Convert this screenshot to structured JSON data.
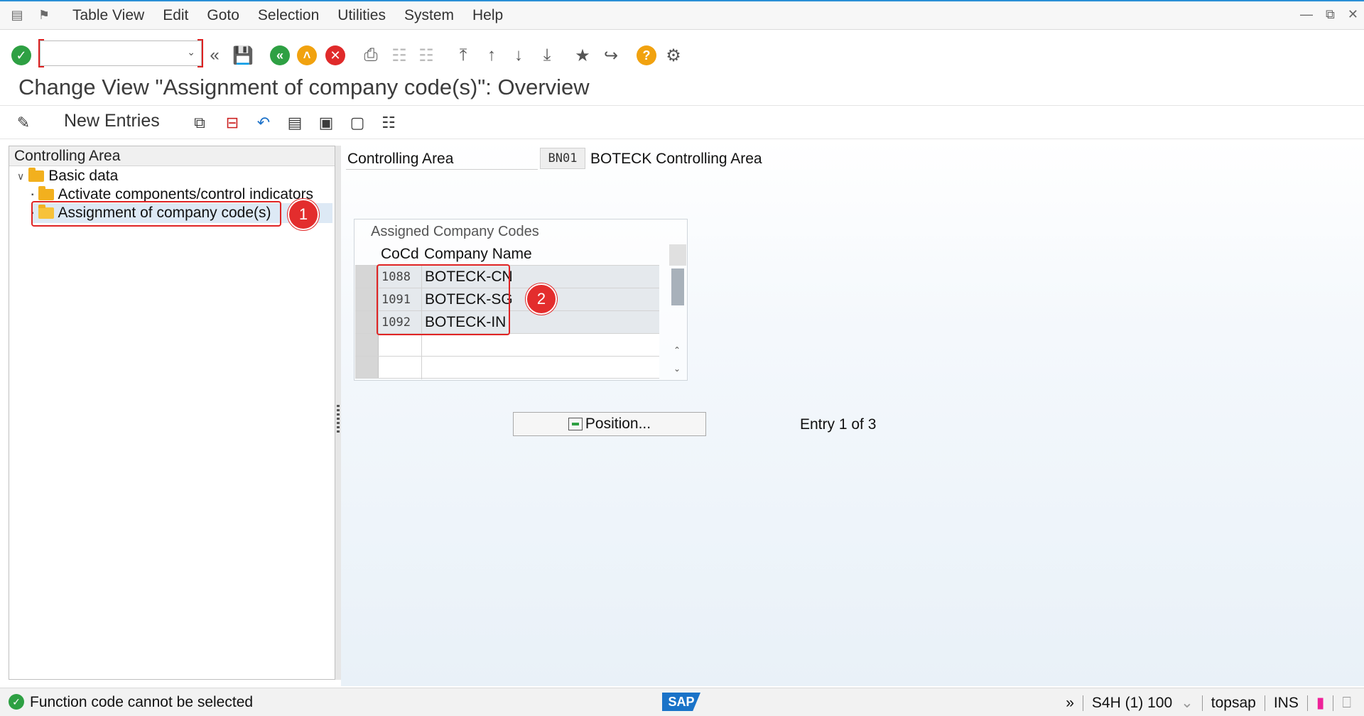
{
  "menubar": {
    "items": [
      "Table View",
      "Edit",
      "Goto",
      "Selection",
      "Utilities",
      "System",
      "Help"
    ]
  },
  "toolbar": {
    "command_field_value": ""
  },
  "page_title": "Change View \"Assignment of company code(s)\": Overview",
  "app_toolbar": {
    "new_entries_label": "New Entries"
  },
  "tree": {
    "header": "Controlling Area",
    "nodes": [
      {
        "label": "Basic data"
      },
      {
        "label": "Activate components/control indicators"
      },
      {
        "label": "Assignment of company code(s)"
      }
    ],
    "badge_1": "1"
  },
  "detail": {
    "controlling_area_label": "Controlling Area",
    "controlling_area_value": "BN01",
    "controlling_area_desc": "BOTECK Controlling Area",
    "table_title": "Assigned Company Codes",
    "columns": [
      "CoCd",
      "Company Name"
    ],
    "rows": [
      {
        "cocd": "1088",
        "name": "BOTECK-CN"
      },
      {
        "cocd": "1091",
        "name": "BOTECK-SG"
      },
      {
        "cocd": "1092",
        "name": "BOTECK-IN"
      }
    ],
    "badge_2": "2",
    "position_button_label": "Position...",
    "entry_text": "Entry 1 of 3"
  },
  "statusbar": {
    "message": "Function code cannot be selected",
    "logo": "SAP",
    "system": "S4H (1) 100",
    "user": "topsap",
    "mode": "INS"
  },
  "colors": {
    "accent_blue": "#2a8fd6",
    "ok_green": "#2ea043",
    "cancel_red": "#e02a2a",
    "annotation_red": "#e32d2d",
    "selection_blue": "#dde9f5"
  }
}
